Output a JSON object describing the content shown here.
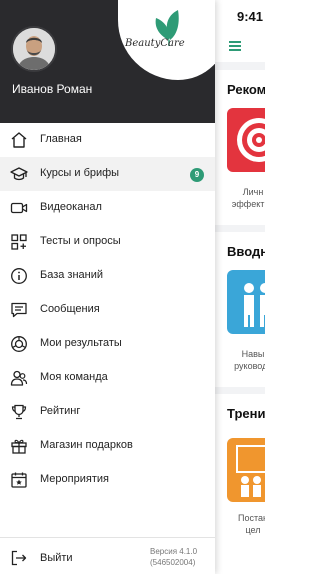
{
  "status_bar": {
    "time": "9:41"
  },
  "brand": {
    "name": "BeautyCare",
    "accent": "#2e9b76"
  },
  "user": {
    "name": "Иванов Роман"
  },
  "menu": {
    "items": [
      {
        "label": "Главная",
        "icon": "home-icon"
      },
      {
        "label": "Курсы и брифы",
        "icon": "graduation-cap-icon",
        "badge": "9",
        "active": true
      },
      {
        "label": "Видеоканал",
        "icon": "video-camera-icon"
      },
      {
        "label": "Тесты и опросы",
        "icon": "grid-apps-icon"
      },
      {
        "label": "База знаний",
        "icon": "info-icon"
      },
      {
        "label": "Сообщения",
        "icon": "chat-icon"
      },
      {
        "label": "Мои результаты",
        "icon": "results-icon"
      },
      {
        "label": "Моя команда",
        "icon": "team-icon"
      },
      {
        "label": "Рейтинг",
        "icon": "trophy-icon"
      },
      {
        "label": "Магазин подарков",
        "icon": "gift-icon"
      },
      {
        "label": "Мероприятия",
        "icon": "calendar-star-icon"
      }
    ]
  },
  "footer": {
    "logout_label": "Выйти",
    "version_line1": "Версия 4.1.0",
    "version_line2": "(546502004)"
  },
  "background": {
    "sections": [
      {
        "title": "Рекоме",
        "card_text_1": "Личн",
        "card_text_2": "эффектив"
      },
      {
        "title": "Вводны",
        "card_text_1": "Навы",
        "card_text_2": "руководс"
      },
      {
        "title": "Трени",
        "card_text_1": "Постан",
        "card_text_2": "цел"
      }
    ]
  }
}
